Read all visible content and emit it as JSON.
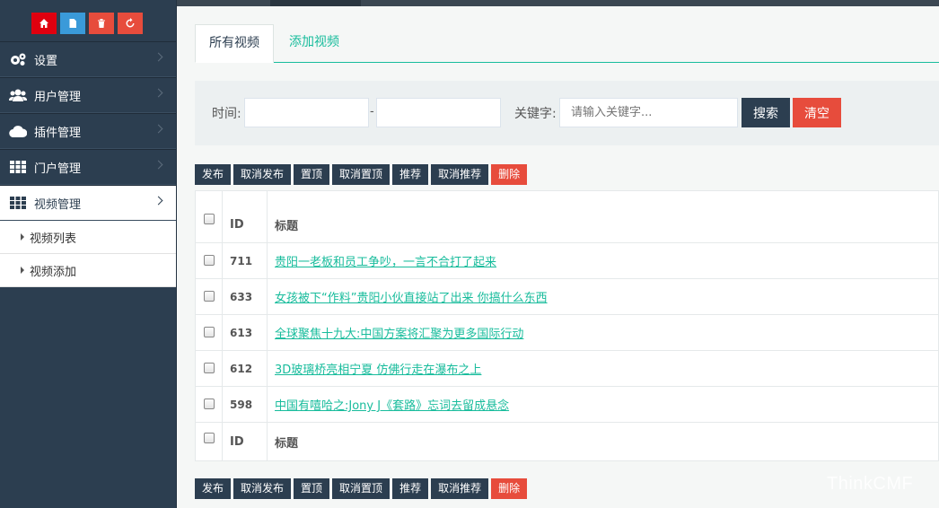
{
  "quick_buttons": [
    {
      "icon": "home-icon",
      "color": "#e0000f"
    },
    {
      "icon": "file-icon",
      "color": "#3a9ad9"
    },
    {
      "icon": "trash-icon",
      "color": "#e74c3c"
    },
    {
      "icon": "recycle-icon",
      "color": "#e74c3c"
    }
  ],
  "sidebar": {
    "items": [
      {
        "label": "设置",
        "icon": "cogs-icon"
      },
      {
        "label": "用户管理",
        "icon": "users-icon"
      },
      {
        "label": "插件管理",
        "icon": "cloud-icon"
      },
      {
        "label": "门户管理",
        "icon": "grid-icon"
      },
      {
        "label": "视频管理",
        "icon": "grid-icon",
        "open": true
      }
    ],
    "sub_items": [
      {
        "label": "视频列表"
      },
      {
        "label": "视频添加"
      }
    ]
  },
  "tabs": [
    {
      "label": "所有视频",
      "active": true
    },
    {
      "label": "添加视频",
      "active": false
    }
  ],
  "search": {
    "time_label": "时间:",
    "date_separator": "-",
    "start_value": "",
    "end_value": "",
    "keyword_label": "关键字:",
    "keyword_placeholder": "请输入关键字...",
    "search_button": "搜索",
    "clear_button": "清空"
  },
  "actions": [
    {
      "label": "发布",
      "danger": false
    },
    {
      "label": "取消发布",
      "danger": false
    },
    {
      "label": "置顶",
      "danger": false
    },
    {
      "label": "取消置顶",
      "danger": false
    },
    {
      "label": "推荐",
      "danger": false
    },
    {
      "label": "取消推荐",
      "danger": false
    },
    {
      "label": "删除",
      "danger": true
    }
  ],
  "table": {
    "columns": [
      "ID",
      "标题"
    ],
    "rows": [
      {
        "id": "711",
        "title": "贵阳一老板和员工争吵，一言不合打了起来"
      },
      {
        "id": "633",
        "title": "女孩被下“作料”贵阳小伙直接站了出来 你搞什么东西"
      },
      {
        "id": "613",
        "title": "全球聚焦十九大:中国方案将汇聚为更多国际行动"
      },
      {
        "id": "612",
        "title": "3D玻璃桥亮相宁夏 仿佛行走在瀑布之上"
      },
      {
        "id": "598",
        "title": "中国有嘻哈之:Jony J《套路》忘词去留成悬念"
      }
    ]
  },
  "watermark": "ThinkCMF",
  "colors": {
    "sidebar_bg": "#2c3e50",
    "accent": "#18bc9c",
    "danger": "#e74c3c",
    "dark_button": "#2c3e50"
  }
}
